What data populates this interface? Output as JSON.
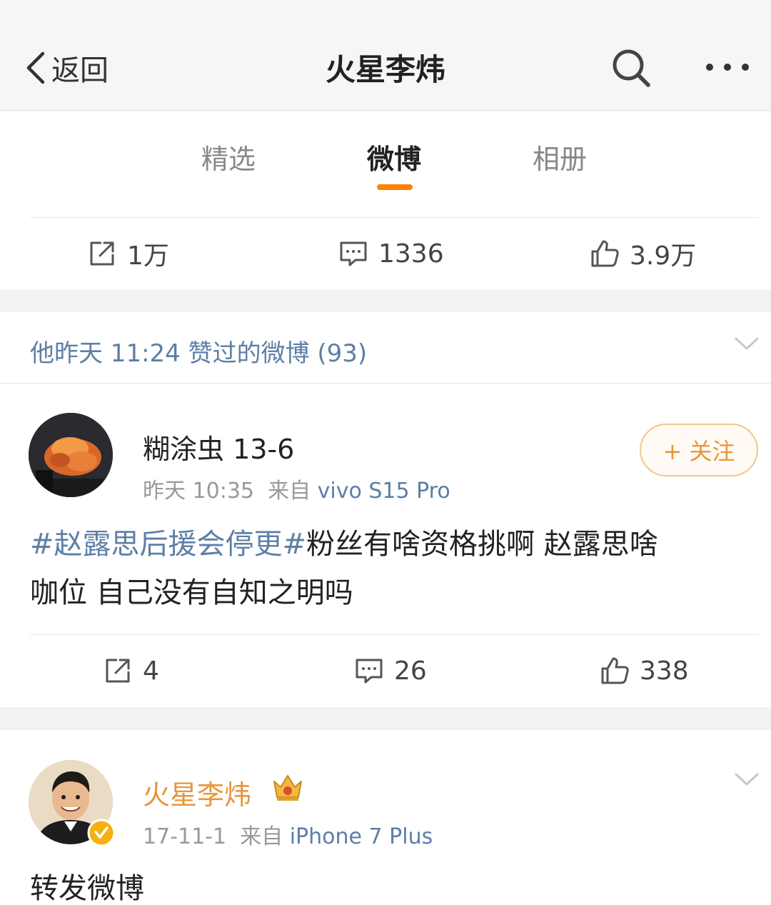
{
  "nav": {
    "back_label": "返回",
    "title": "火星李炜",
    "search_icon": "search-icon",
    "more_icon": "more-icon"
  },
  "tabs": [
    {
      "label": "精选",
      "active": false
    },
    {
      "label": "微博",
      "active": true
    },
    {
      "label": "相册",
      "active": false
    }
  ],
  "colors": {
    "accent": "#ff8200",
    "link": "#5d7fa6",
    "follow_border": "#f0c78a",
    "follow_text": "#e8963a",
    "vip_gold": "#f5b10f"
  },
  "top_actions": {
    "repost_count": "1万",
    "comment_count": "1336",
    "like_count": "3.9万"
  },
  "liked_header": {
    "text": "他昨天 11:24 赞过的微博 (93)"
  },
  "post1": {
    "username": "糊涂虫 13-6",
    "time": "昨天 10:35",
    "from_label": "来自",
    "source": "vivo S15 Pro",
    "follow_label": "+ 关注",
    "hashtag": "#赵露思后援会停更#",
    "text_rest": "粉丝有啥资格挑啊  赵露思啥",
    "text_line2": "咖位  自己没有自知之明吗",
    "repost_count": "4",
    "comment_count": "26",
    "like_count": "338"
  },
  "post2": {
    "username": "火星李炜",
    "time": "17-11-1",
    "from_label": "来自",
    "source": "iPhone 7 Plus",
    "text": "转发微博"
  }
}
